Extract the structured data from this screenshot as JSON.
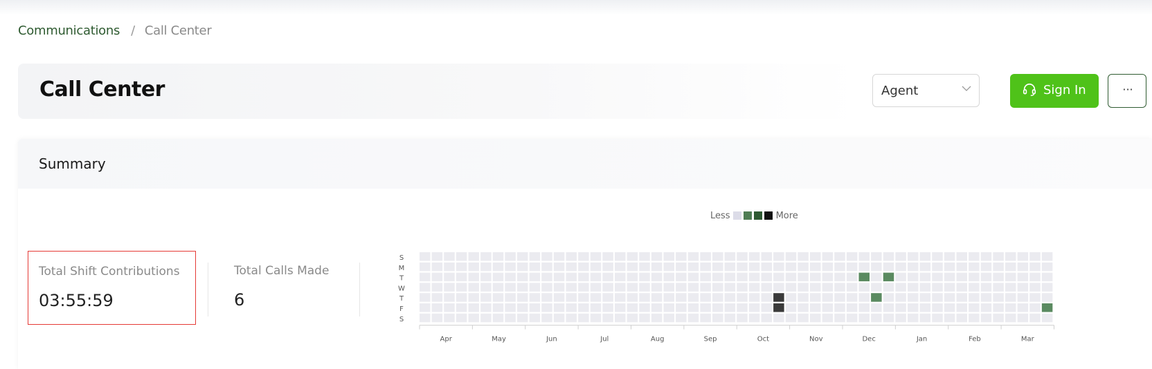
{
  "breadcrumb": {
    "parent": "Communications",
    "separator": "/",
    "current": "Call Center"
  },
  "header": {
    "title": "Call Center",
    "role_select": {
      "value": "Agent"
    },
    "sign_in_label": "Sign In",
    "more_label": "···"
  },
  "summary": {
    "title": "Summary",
    "stats": [
      {
        "label": "Total Shift Contributions",
        "value": "03:55:59"
      },
      {
        "label": "Total Calls Made",
        "value": "6"
      }
    ]
  },
  "legend": {
    "less": "Less",
    "more": "More",
    "colors": [
      "#dcdce8",
      "#4f7d54",
      "#2e5a32",
      "#111111"
    ]
  },
  "colors": {
    "brand_green": "#4fc219",
    "dark_green": "#2f5b31",
    "empty_cell": "#ebebf0"
  },
  "chart_data": {
    "type": "heatmap",
    "weekday_labels": [
      "S",
      "M",
      "T",
      "W",
      "T",
      "F",
      "S"
    ],
    "month_labels": [
      "Apr",
      "May",
      "Jun",
      "Jul",
      "Aug",
      "Sep",
      "Oct",
      "Nov",
      "Dec",
      "Jan",
      "Feb",
      "Mar"
    ],
    "weeks": 52,
    "active_cells": [
      {
        "week": 29,
        "day": 4,
        "level": 3
      },
      {
        "week": 29,
        "day": 5,
        "level": 3
      },
      {
        "week": 36,
        "day": 2,
        "level": 1
      },
      {
        "week": 37,
        "day": 4,
        "level": 1
      },
      {
        "week": 38,
        "day": 2,
        "level": 1
      },
      {
        "week": 51,
        "day": 5,
        "level": 1
      }
    ]
  }
}
